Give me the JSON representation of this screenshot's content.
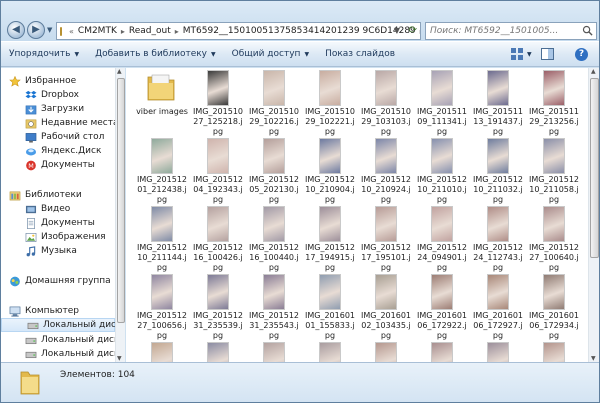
{
  "address": {
    "breadcrumbs": [
      "CM2MTK",
      "Read_out",
      "MT6592__15010051375853414201239 9C6D14289"
    ],
    "search_placeholder": "Поиск: MT6592__1501005..."
  },
  "toolbar": {
    "organize": "Упорядочить",
    "add_library": "Добавить в библиотеку",
    "share": "Общий доступ",
    "slideshow": "Показ слайдов"
  },
  "nav": {
    "favorites": "Избранное",
    "dropbox": "Dropbox",
    "downloads": "Загрузки",
    "recent": "Недавние места",
    "desktop": "Рабочий стол",
    "yadisk": "Яндекс.Диск",
    "documents_fav": "Документы",
    "libraries": "Библиотеки",
    "video": "Видео",
    "documents": "Документы",
    "images": "Изображения",
    "music": "Музыка",
    "homegroup": "Домашняя группа",
    "computer": "Компьютер",
    "disk_c": "Локальный диск (C",
    "disk_d": "Локальный диск (D",
    "disk_e": "Локальный диск (E"
  },
  "files": [
    {
      "name": "viber images",
      "kind": "folder"
    },
    {
      "name": "IMG_20151027_125218.jpg",
      "kind": "image",
      "color": "#3a3a3a"
    },
    {
      "name": "IMG_20151029_102216.jpg",
      "kind": "image",
      "color": "#c9b6aa"
    },
    {
      "name": "IMG_20151029_102221.jpg",
      "kind": "image",
      "color": "#c8ada0"
    },
    {
      "name": "IMG_20151029_103103.jpg",
      "kind": "image",
      "color": "#b9a8a6"
    },
    {
      "name": "IMG_20151109_111341.jpg",
      "kind": "image",
      "color": "#a7a2b5"
    },
    {
      "name": "IMG_20151113_191437.jpg",
      "kind": "image",
      "color": "#6c6b8f"
    },
    {
      "name": "IMG_20151129_213256.jpg",
      "kind": "image",
      "color": "#9b5f68"
    },
    {
      "name": "IMG_20151201_212438.jpg",
      "kind": "image",
      "color": "#8faa9c"
    },
    {
      "name": "IMG_20151204_192343.jpg",
      "kind": "image",
      "color": "#cfb4ad"
    },
    {
      "name": "IMG_20151205_202130.jpg",
      "kind": "image",
      "color": "#b49f9b"
    },
    {
      "name": "IMG_20151210_210904.jpg",
      "kind": "image",
      "color": "#6d7aa0"
    },
    {
      "name": "IMG_20151210_210924.jpg",
      "kind": "image",
      "color": "#7c86a8"
    },
    {
      "name": "IMG_20151210_211010.jpg",
      "kind": "image",
      "color": "#8690ae"
    },
    {
      "name": "IMG_20151210_211032.jpg",
      "kind": "image",
      "color": "#6f7d9e"
    },
    {
      "name": "IMG_20151210_211058.jpg",
      "kind": "image",
      "color": "#8a8fa8"
    },
    {
      "name": "IMG_20151210_211144.jpg",
      "kind": "image",
      "color": "#7f8ba6"
    },
    {
      "name": "IMG_20151216_100426.jpg",
      "kind": "image",
      "color": "#b5a2a0"
    },
    {
      "name": "IMG_20151216_100440.jpg",
      "kind": "image",
      "color": "#a29aa6"
    },
    {
      "name": "IMG_20151217_194915.jpg",
      "kind": "image",
      "color": "#9d8f9a"
    },
    {
      "name": "IMG_20151217_195101.jpg",
      "kind": "image",
      "color": "#b79c97"
    },
    {
      "name": "IMG_20151224_094901.jpg",
      "kind": "image",
      "color": "#c1a3a0"
    },
    {
      "name": "IMG_20151224_112743.jpg",
      "kind": "image",
      "color": "#b08e88"
    },
    {
      "name": "IMG_20151227_100640.jpg",
      "kind": "image",
      "color": "#aa8c8c"
    },
    {
      "name": "IMG_20151227_100656.jpg",
      "kind": "image",
      "color": "#8f86a0"
    },
    {
      "name": "IMG_20151231_235539.jpg",
      "kind": "image",
      "color": "#7d7a96"
    },
    {
      "name": "IMG_20151231_235543.jpg",
      "kind": "image",
      "color": "#8a7d95"
    },
    {
      "name": "IMG_20160101_155833.jpg",
      "kind": "image",
      "color": "#8f9db0"
    },
    {
      "name": "IMG_20160102_103435.jpg",
      "kind": "image",
      "color": "#a89f93"
    },
    {
      "name": "IMG_20160106_172922.jpg",
      "kind": "image",
      "color": "#9c7d74"
    },
    {
      "name": "IMG_20160106_172927.jpg",
      "kind": "image",
      "color": "#a88778"
    },
    {
      "name": "IMG_20160106_172934.jpg",
      "kind": "image",
      "color": "#8f7b73"
    },
    {
      "name": "",
      "kind": "image",
      "color": "#c2a791"
    },
    {
      "name": "",
      "kind": "image",
      "color": "#8b8ca3"
    },
    {
      "name": "",
      "kind": "image",
      "color": "#b3a2a0"
    },
    {
      "name": "",
      "kind": "image",
      "color": "#a99c9f"
    },
    {
      "name": "",
      "kind": "image",
      "color": "#b5988f"
    },
    {
      "name": "",
      "kind": "image",
      "color": "#a88e8f"
    },
    {
      "name": "",
      "kind": "image",
      "color": "#9c8f9b"
    },
    {
      "name": "",
      "kind": "image",
      "color": "#b3948c"
    }
  ],
  "details": {
    "count": "Элементов: 104"
  }
}
